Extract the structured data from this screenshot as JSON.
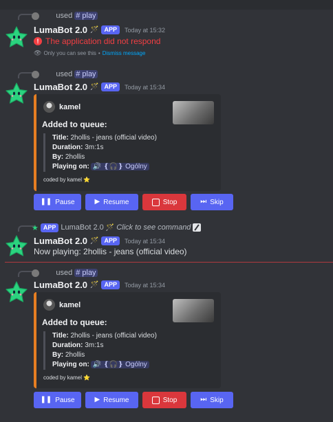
{
  "messages": {
    "m1": {
      "reply_used": "used",
      "reply_cmd": "# play",
      "bot_name": "LumaBot 2.0",
      "app_tag": "APP",
      "timestamp": "Today at 15:32",
      "error": "The application did not respond",
      "ephemeral": "Only you can see this",
      "sep": "•",
      "dismiss": "Dismiss message"
    },
    "m2": {
      "reply_used": "used",
      "reply_cmd": "# play",
      "bot_name": "LumaBot 2.0",
      "app_tag": "APP",
      "timestamp": "Today at 15:34"
    },
    "m3": {
      "reply_tag": "APP",
      "reply_name": "LumaBot 2.0",
      "reply_click": "Click to see command",
      "bot_name": "LumaBot 2.0",
      "app_tag": "APP",
      "timestamp": "Today at 15:34",
      "text": "Now playing: 2hollis - jeans (official video)"
    },
    "m4": {
      "reply_used": "used",
      "reply_cmd": "# play",
      "bot_name": "LumaBot 2.0",
      "app_tag": "APP",
      "timestamp": "Today at 15:34"
    }
  },
  "embed": {
    "author": "kamel",
    "title": "Added to queue:",
    "title_label": "Title:",
    "title_value": "2hollis - jeans (official video)",
    "duration_label": "Duration:",
    "duration_value": "3m:1s",
    "by_label": "By:",
    "by_value": "2hollis",
    "playing_label": "Playing on:",
    "playing_value": "🔊 ❴🎧❵ Ogólny",
    "footer": "coded by kamel",
    "accent": "#e67e22"
  },
  "buttons": {
    "pause": "Pause",
    "resume": "Resume",
    "stop": "Stop",
    "skip": "Skip"
  },
  "colors": {
    "background": "#313338",
    "blurple": "#5865f2",
    "danger": "#da373c",
    "error_text": "#f23f43",
    "link": "#00a8fc",
    "divider": "#b03a3f"
  },
  "icons": {
    "avatar": "green-star-icon",
    "pause": "pause-icon",
    "play": "play-icon",
    "stop": "stop-icon",
    "skip": "skip-icon",
    "error": "error-icon",
    "eye": "eye-icon",
    "edit": "edit-icon"
  }
}
